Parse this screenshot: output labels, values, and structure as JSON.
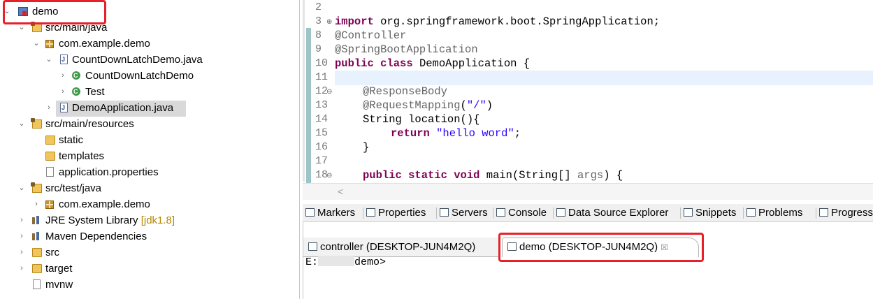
{
  "tree": {
    "items": [
      {
        "label": "demo",
        "dim": ""
      },
      {
        "label": "src/main/java",
        "dim": ""
      },
      {
        "label": "com.example.demo",
        "dim": ""
      },
      {
        "label": "CountDownLatchDemo.java",
        "dim": ""
      },
      {
        "label": "CountDownLatchDemo",
        "dim": ""
      },
      {
        "label": "Test",
        "dim": ""
      },
      {
        "label": "DemoApplication.java",
        "dim": ""
      },
      {
        "label": "src/main/resources",
        "dim": ""
      },
      {
        "label": "static",
        "dim": ""
      },
      {
        "label": "templates",
        "dim": ""
      },
      {
        "label": "application.properties",
        "dim": ""
      },
      {
        "label": "src/test/java",
        "dim": ""
      },
      {
        "label": "com.example.demo",
        "dim": ""
      },
      {
        "label": "JRE System Library ",
        "dim": "[jdk1.8]"
      },
      {
        "label": "Maven Dependencies",
        "dim": ""
      },
      {
        "label": "src",
        "dim": ""
      },
      {
        "label": "target",
        "dim": ""
      },
      {
        "label": "mvnw",
        "dim": ""
      }
    ],
    "selected": "DemoApplication.java"
  },
  "editor": {
    "lines": [
      {
        "num": "2",
        "fold": ""
      },
      {
        "num": "3",
        "fold": "⊕"
      },
      {
        "num": "8",
        "fold": ""
      },
      {
        "num": "9",
        "fold": ""
      },
      {
        "num": "10",
        "fold": ""
      },
      {
        "num": "11",
        "fold": ""
      },
      {
        "num": "12",
        "fold": "⊖"
      },
      {
        "num": "13",
        "fold": ""
      },
      {
        "num": "14",
        "fold": ""
      },
      {
        "num": "15",
        "fold": ""
      },
      {
        "num": "16",
        "fold": ""
      },
      {
        "num": "17",
        "fold": ""
      },
      {
        "num": "18",
        "fold": "⊖"
      }
    ],
    "code": {
      "l3_kw": "import",
      "l3_rest": " org.springframework.boot.SpringApplication;",
      "l8": "@Controller",
      "l9": "@SpringBootApplication",
      "l10_kw1": "public",
      "l10_kw2": "class",
      "l10_rest": " DemoApplication {",
      "l12": "@ResponseBody",
      "l13_ann": "@RequestMapping",
      "l13_p1": "(",
      "l13_str": "\"/\"",
      "l13_p2": ")",
      "l14": "String location(){",
      "l15_kw": "return",
      "l15_str": "\"hello word\"",
      "l15_end": ";",
      "l16": "}",
      "l18_kw1": "public",
      "l18_kw2": "static",
      "l18_kw3": "void",
      "l18_rest1": " main(String[] ",
      "l18_args": "args",
      "l18_rest2": ") {"
    },
    "scroll_left": "<"
  },
  "views": {
    "tabs": [
      "Markers",
      "Properties",
      "Servers",
      "Console",
      "Data Source Explorer",
      "Snippets",
      "Problems",
      "Progress"
    ]
  },
  "console": {
    "tabs": [
      {
        "label": "controller (DESKTOP-JUN4M2Q)",
        "active": false
      },
      {
        "label": "demo (DESKTOP-JUN4M2Q)",
        "active": true
      }
    ],
    "close_glyph": "☒",
    "prompt_prefix": "E:",
    "prompt_suffix": "demo>"
  },
  "colors": {
    "highlight_box": "#e8202a",
    "keyword": "#7f0055",
    "annotation": "#646464",
    "string": "#2a00ff"
  }
}
